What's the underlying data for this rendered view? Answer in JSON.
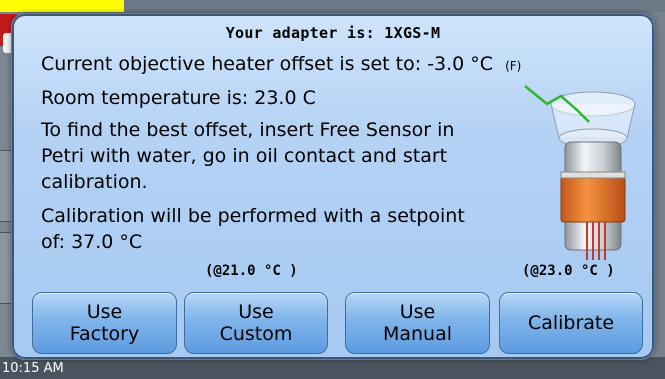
{
  "clock": "10:15 AM",
  "dialog": {
    "title": "Your adapter is: 1XGS-M",
    "offset_line": "Current objective heater offset is set to: -3.0 °C",
    "offset_unit_flag": "(F)",
    "room_temp_line": "Room temperature is: 23.0  C",
    "instruction_line1": "To find the best offset, insert Free Sensor in",
    "instruction_line2": "Petri with water, go in oil contact and start",
    "instruction_line3": "calibration.",
    "setpoint_line1": "Calibration will be performed with a setpoint",
    "setpoint_line2": "of: 37.0  °C",
    "custom_note": "(@21.0 °C )",
    "calibrate_note": "(@23.0 °C )",
    "buttons": {
      "factory_line1": "Use",
      "factory_line2": "Factory",
      "custom_line1": "Use",
      "custom_line2": "Custom",
      "manual_line1": "Use",
      "manual_line2": "Manual",
      "calibrate": "Calibrate"
    }
  },
  "colors": {
    "dialog_bg": "#b4d2f4",
    "button_bg": "#7fb4ea",
    "heater_band": "#f07a2a",
    "background_accent": "#c11a1a",
    "highlight": "#ffff00"
  }
}
